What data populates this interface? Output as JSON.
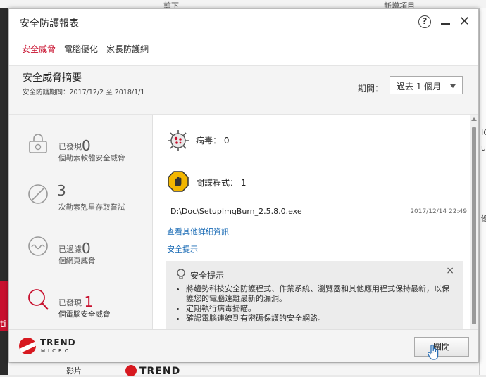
{
  "background": {
    "top_fragment_1": "剪下",
    "top_fragment_2": "新增項目",
    "left_fragment": "ti",
    "right_fragment_1": "IC",
    "right_fragment_2": "up",
    "right_fragment_3": "優",
    "bottom_logo": "TREND",
    "bottom_item": "影片"
  },
  "window": {
    "title": "安全防護報表",
    "help_label": "?",
    "close_glyph": "✕"
  },
  "tabs": [
    {
      "label": "安全威脅",
      "active": true
    },
    {
      "label": "電腦優化",
      "active": false
    },
    {
      "label": "家長防護網",
      "active": false
    }
  ],
  "summary": {
    "title": "安全威脅摘要",
    "period_text": "安全防護期間：2017/12/2 至 2018/1/1",
    "period_label": "期間：",
    "period_value": "過去 1 個月"
  },
  "stats": [
    {
      "prefix": "已發現",
      "value": "0",
      "desc": "個勒索軟體安全威脅",
      "icon": "lock-icon"
    },
    {
      "value": "3",
      "desc": "次勒索剋星存取嘗試",
      "icon": "blocked-icon"
    },
    {
      "prefix": "已過濾",
      "value": "0",
      "desc": "個網頁威脅",
      "icon": "web-threat-icon"
    },
    {
      "prefix": "已發現",
      "value": "1",
      "desc": "個電腦安全威脅",
      "icon": "magnifier-icon"
    }
  ],
  "detail": {
    "virus_label": "病毒：",
    "virus_count": "0",
    "spyware_label": "間諜程式：",
    "spyware_count": "1",
    "file_path": "D:\\Doc\\SetupImgBurn_2.5.8.0.exe",
    "file_time": "2017/12/14 22:49",
    "more_link": "查看其他詳細資訊",
    "tip_link": "安全提示"
  },
  "tip_box": {
    "title": "安全提示",
    "close_glyph": "×",
    "items": [
      "將趨勢科技安全防護程式、作業系統、瀏覽器和其他應用程式保持最新，以保護您的電腦遠離最新的漏洞。",
      "定期執行病毒掃瞄。",
      "確認電腦連線到有密碼保護的安全網路。"
    ]
  },
  "footer": {
    "logo_line1": "TREND",
    "logo_line2": "MICRO",
    "close_button": "關閉"
  },
  "colors": {
    "accent_red": "#c8102e",
    "link_blue": "#1a6bb5",
    "warning_yellow": "#f2b600"
  }
}
